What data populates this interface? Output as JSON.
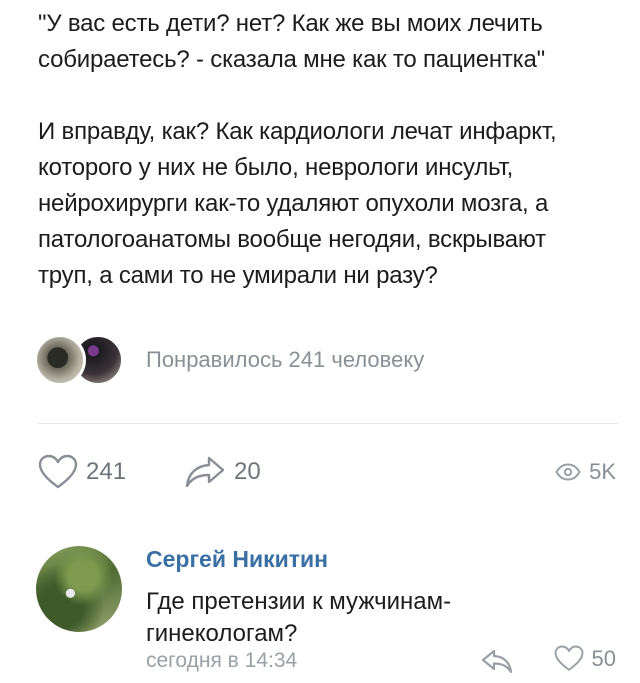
{
  "post": {
    "lines": [
      "\"У вас есть дети? нет? Как же вы моих лечить",
      "собираетесь? - сказала мне как то пациентка\"",
      "",
      "И вправду, как? Как кардиологи лечат инфаркт,",
      "которого у них не было, неврологи инсульт,",
      "нейрохирурги как-то удаляют опухоли мозга, а",
      "патологоанатомы вообще негодяи, вскрывают",
      "труп, а сами то не умирали ни разу?"
    ]
  },
  "likers": {
    "text": "Понравилось 241 человеку"
  },
  "actions": {
    "likes": "241",
    "shares": "20",
    "views": "5K"
  },
  "comment": {
    "author": "Сергей Никитин",
    "text_lines": [
      "Где претензии к мужчинам-",
      "гинекологам?"
    ],
    "time": "сегодня в 14:34",
    "likes": "50"
  },
  "colors": {
    "link": "#3a6fa4",
    "muted": "#8a8f96",
    "divider": "#e4e6ea"
  },
  "icons": [
    "heart-outline-icon",
    "share-arrow-icon",
    "eye-icon",
    "reply-arrow-icon"
  ]
}
